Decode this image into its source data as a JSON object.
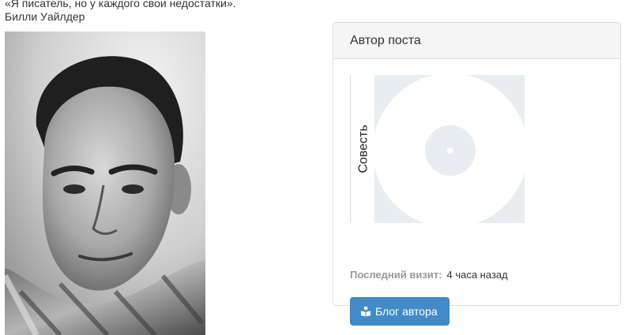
{
  "post": {
    "quote": "«Я писатель, но у каждого свои недостатки». Билли Уайлдер"
  },
  "author_panel": {
    "title": "Автор поста",
    "author_name": "Совесть",
    "last_visit_label": "Последний визит:",
    "last_visit_value": "4 часа назад",
    "blog_button_label": "Блог автора",
    "blog_button_icon": "user-book-icon"
  },
  "colors": {
    "button_bg": "#428bca",
    "panel_heading_bg": "#f5f5f5",
    "avatar_bg": "#e8edf1"
  }
}
